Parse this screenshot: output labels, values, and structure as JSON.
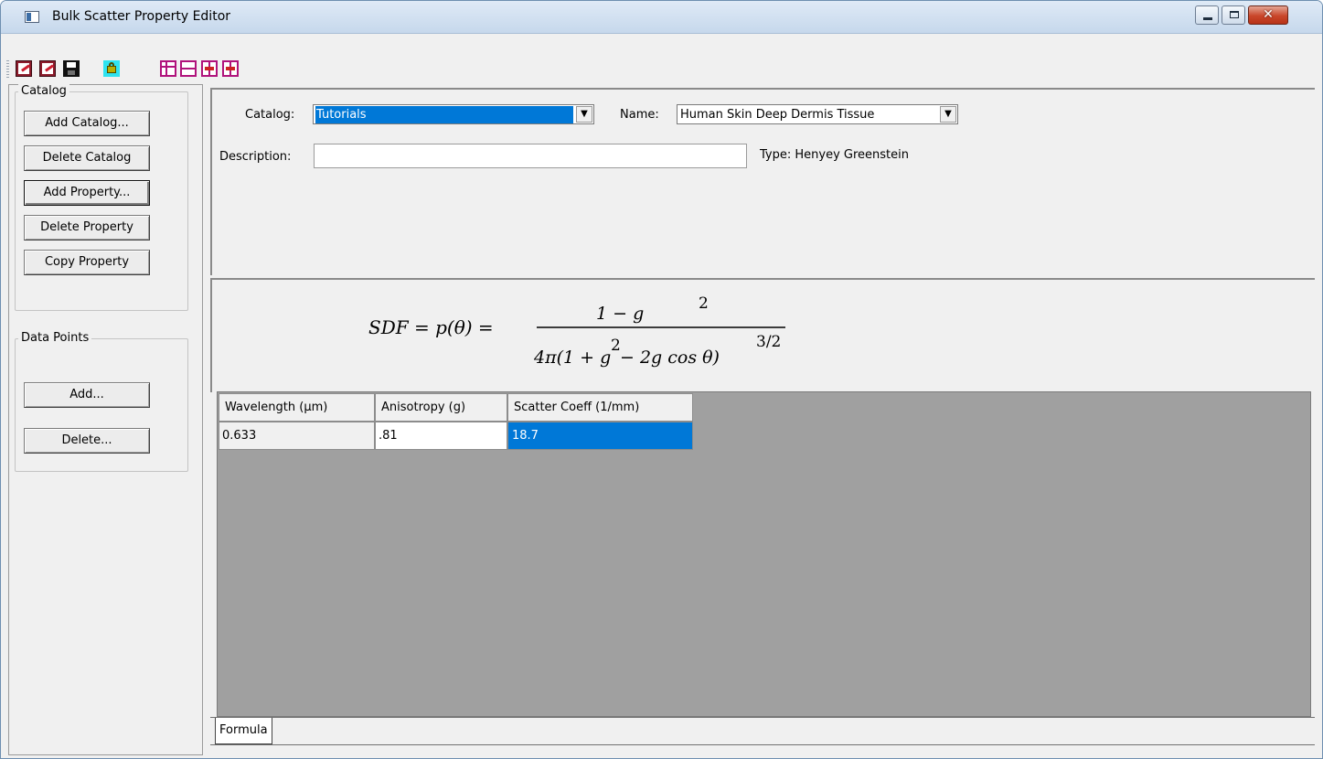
{
  "window": {
    "title": "Bulk Scatter Property Editor",
    "controls": {
      "minimize": "minimize",
      "maximize": "maximize",
      "close": "✕"
    }
  },
  "toolbar": {
    "buttons": [
      {
        "icon": "export-icon"
      },
      {
        "icon": "import-icon"
      },
      {
        "icon": "save-icon"
      },
      {
        "icon": "lock-icon"
      },
      {
        "icon": "column-layout-icon"
      },
      {
        "icon": "row-layout-icon"
      },
      {
        "icon": "insert-row-icon"
      },
      {
        "icon": "move-row-up-icon"
      }
    ]
  },
  "catalog_group": {
    "label": "Catalog",
    "buttons": [
      "Add Catalog...",
      "Delete Catalog",
      "Add  Property...",
      "Delete Property",
      "Copy Property"
    ]
  },
  "datapoints_group": {
    "label": "Data Points",
    "add_label": "Add...",
    "delete_label": "Delete..."
  },
  "form": {
    "catalog_label": "Catalog:",
    "catalog_value": "Tutorials",
    "name_label": "Name:",
    "name_value": "Human Skin Deep Dermis Tissue",
    "description_label": "Description:",
    "description_value": "",
    "type_text": "Type: Henyey Greenstein"
  },
  "formula": {
    "lhs": "SDF = p(θ) =",
    "numerator": "1 − g",
    "numerator_exp": "2",
    "denominator_prefix": "4π(1 + g",
    "denominator_exp": "2",
    "denominator_suffix": " − 2g cos θ)",
    "outer_exp": "3/2"
  },
  "table": {
    "columns": [
      "Wavelength (μm)",
      "Anisotropy (g)",
      "Scatter Coeff (1/mm)"
    ],
    "rows": [
      [
        "0.633",
        ".81",
        "18.7"
      ]
    ]
  },
  "tabs": [
    "Formula"
  ],
  "colors": {
    "selection": "#0078d7",
    "grid_background": "#a0a0a0",
    "accent_icons": "#b0127c"
  }
}
